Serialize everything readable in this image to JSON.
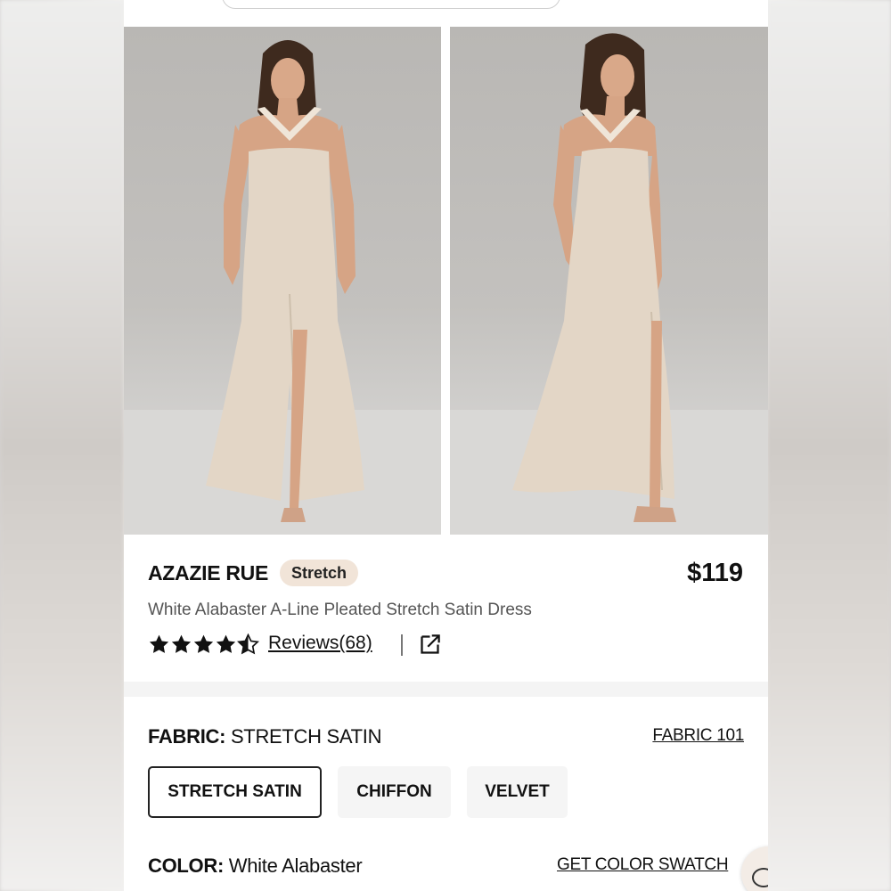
{
  "product": {
    "brand": "AZAZIE RUE",
    "tag": "Stretch",
    "price": "$119",
    "description": "White Alabaster A-Line Pleated Stretch Satin Dress",
    "rating": 4.5,
    "reviews_label": "Reviews(68)"
  },
  "fabric": {
    "label": "FABRIC:",
    "value": "STRETCH SATIN",
    "link": "FABRIC 101",
    "options": [
      "STRETCH SATIN",
      "CHIFFON",
      "VELVET"
    ],
    "selected": "STRETCH SATIN"
  },
  "color": {
    "label": "COLOR:",
    "value": "White Alabaster",
    "link": "GET COLOR SWATCH"
  },
  "icons": {
    "star": "star-icon",
    "external": "external-link-icon",
    "chat": "chat-icon"
  },
  "colors": {
    "dress": "#e3d6c6",
    "tag_bg": "#f1e4d8",
    "backdrop": "#bebcb9"
  }
}
